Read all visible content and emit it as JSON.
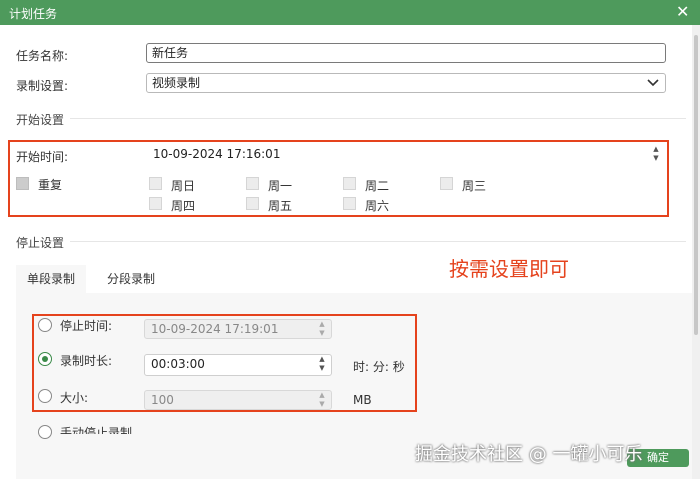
{
  "window": {
    "title": "计划任务",
    "close_glyph": "✕"
  },
  "task_name": {
    "label": "任务名称:",
    "value": "新任务"
  },
  "record_setting": {
    "label": "录制设置:",
    "value": "视频录制"
  },
  "start_section": {
    "heading": "开始设置",
    "start_time_label": "开始时间:",
    "start_time_value": "10-09-2024 17:16:01",
    "repeat_label": "重复",
    "weekdays": [
      "周日",
      "周一",
      "周二",
      "周三",
      "周四",
      "周五",
      "周六"
    ]
  },
  "stop_section": {
    "heading": "停止设置",
    "tabs": [
      "单段录制",
      "分段录制"
    ],
    "stop_time_label": "停止时间:",
    "stop_time_value": "10-09-2024 17:19:01",
    "duration_label": "录制时长:",
    "duration_value": "00:03:00",
    "duration_unit": "时: 分: 秒",
    "size_label": "大小:",
    "size_value": "100",
    "size_unit": "MB",
    "manual_stop_label": "手动停止录制"
  },
  "annotation": "按需设置即可",
  "watermark": "掘金技术社区 @ 一罐小可乐",
  "ok_button": "确定",
  "colors": {
    "accent": "#4e9a5c",
    "highlight": "#e5431d"
  },
  "icons": {
    "close": "close-icon",
    "dropdown": "chevron-down-icon",
    "spin": "spin-arrows-icon"
  }
}
